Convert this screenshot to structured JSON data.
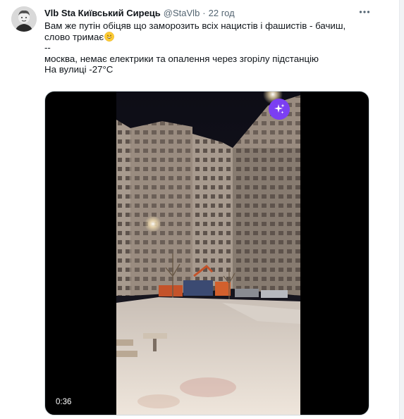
{
  "tweet": {
    "author": {
      "display_name": "Vlb Sta Київський Сирець",
      "handle": "@StaVlb",
      "separator": "·",
      "time": "22 год"
    },
    "more_icon": "more-horizontal-icon",
    "text_lines": [
      "Вам же путін обіцяв що заморозить всіх нацистів і фашистів - бачиш,",
      "слово тримає",
      "--",
      "москва, немає електрики та опалення через згорілу підстанцію",
      "На вулиці -27°C"
    ],
    "emoji": "grinning-face-with-smiling-eyes-emoji",
    "media": {
      "type": "video",
      "duration": "0:36",
      "badge_icon": "sparkles-icon",
      "badge_color": "#7b3ff2"
    }
  }
}
